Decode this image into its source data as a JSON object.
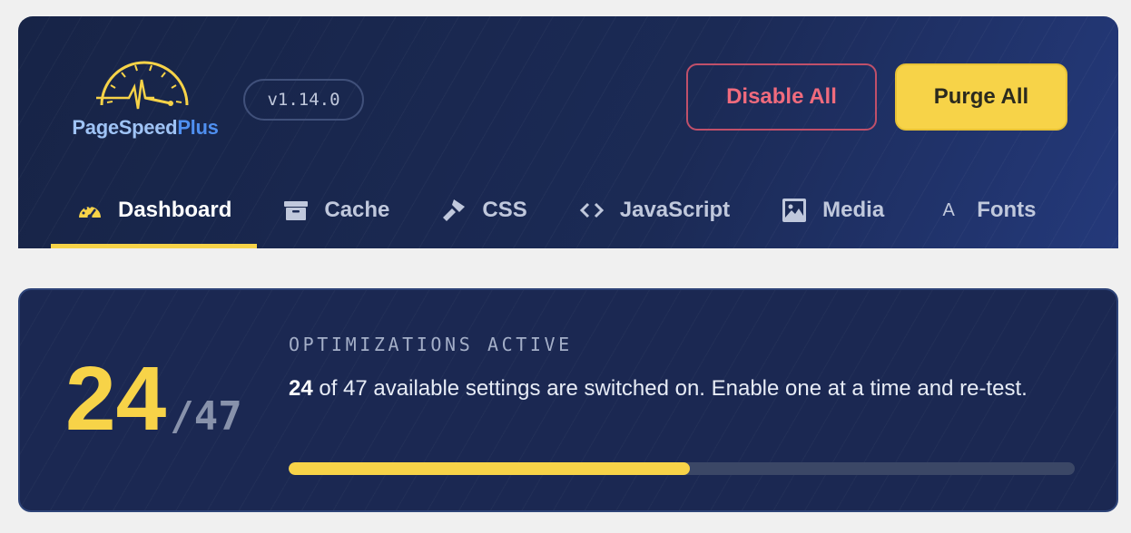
{
  "brand": {
    "name_part1": "PageSpeed",
    "name_part2": "Plus",
    "version": "v1.14.0"
  },
  "actions": {
    "disable_all": "Disable All",
    "purge_all": "Purge All"
  },
  "tabs": [
    {
      "label": "Dashboard",
      "icon": "gauge-icon",
      "active": true
    },
    {
      "label": "Cache",
      "icon": "archive-box-icon",
      "active": false
    },
    {
      "label": "CSS",
      "icon": "paintbrush-icon",
      "active": false
    },
    {
      "label": "JavaScript",
      "icon": "code-brackets-icon",
      "active": false
    },
    {
      "label": "Media",
      "icon": "image-icon",
      "active": false
    },
    {
      "label": "Fonts",
      "icon": "font-letter-icon",
      "active": false
    }
  ],
  "summary": {
    "active_count": "24",
    "total_label": "/47",
    "title": "OPTIMIZATIONS ACTIVE",
    "desc_count": "24",
    "desc_text": " of 47 available settings are switched on. Enable one at a time and re-test.",
    "progress_fraction": 0.51
  },
  "colors": {
    "accent": "#f7d348",
    "danger": "#f06b7d",
    "header_bg": "#1b2a55",
    "card_bg": "#1b2852"
  }
}
